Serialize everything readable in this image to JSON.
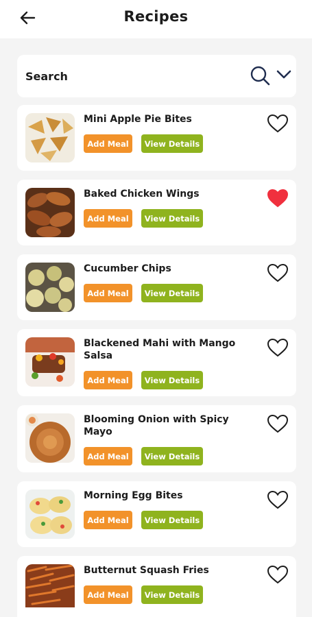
{
  "header": {
    "back_icon": "arrow-left-icon",
    "title": "Recipes"
  },
  "search": {
    "placeholder": "Search",
    "value": "",
    "search_icon": "magnifier-icon",
    "dropdown_icon": "chevron-down-icon"
  },
  "colors": {
    "add_meal": "#f2922a",
    "view_details": "#8fb31e",
    "favorite_active": "#f0303e",
    "background": "#f4f4f4"
  },
  "recipes": [
    {
      "name": "Mini Apple Pie Bites",
      "add_label": "Add Meal",
      "view_label": "View Details",
      "favorited": false
    },
    {
      "name": "Baked Chicken Wings",
      "add_label": "Add Meal",
      "view_label": "View Details",
      "favorited": true
    },
    {
      "name": "Cucumber Chips",
      "add_label": "Add Meal",
      "view_label": "View Details",
      "favorited": false
    },
    {
      "name": "Blackened Mahi with Mango Salsa",
      "add_label": "Add Meal",
      "view_label": "View Details",
      "favorited": false
    },
    {
      "name": "Blooming Onion with Spicy Mayo",
      "add_label": "Add Meal",
      "view_label": "View Details",
      "favorited": false
    },
    {
      "name": "Morning Egg Bites",
      "add_label": "Add Meal",
      "view_label": "View Details",
      "favorited": false
    },
    {
      "name": "Butternut Squash Fries",
      "add_label": "Add Meal",
      "view_label": "View Details",
      "favorited": false
    }
  ]
}
